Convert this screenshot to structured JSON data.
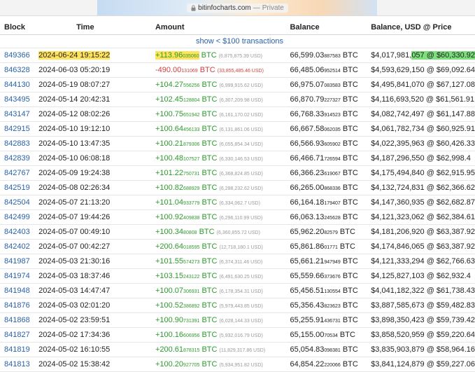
{
  "browser": {
    "host": "bitinfocharts.com",
    "separator": "—",
    "mode": "Private"
  },
  "table": {
    "headers": {
      "block": "Block",
      "time": "Time",
      "amount": "Amount",
      "balance": "Balance",
      "balance_usd": "Balance, USD @ Price"
    },
    "show_small_label": "show < $100 transactions",
    "unit": "BTC",
    "rows": [
      {
        "block": "849366",
        "time": "2024-06-24 19:15:22",
        "amount_main": "+113.96",
        "amount_frac": "035060",
        "amount_usd": "(6,875,875.39 USD)",
        "sign": "pos",
        "balance_main": "66,599.03",
        "balance_frac": "887583",
        "balance_usd": "$4,017,981,057 @ $60,330.92"
      },
      {
        "block": "846328",
        "time": "2024-06-03 05:20:19",
        "amount_main": "-490.00",
        "amount_frac": "131069",
        "amount_usd": "(33,855,485.46 USD)",
        "sign": "neg",
        "balance_main": "66,485.06",
        "balance_frac": "952514",
        "balance_usd": "$4,593,629,150 @ $69,092.64"
      },
      {
        "block": "844130",
        "time": "2024-05-19 08:07:27",
        "amount_main": "+104.27",
        "amount_frac": "556256",
        "amount_usd": "(6,999,915.62 USD)",
        "sign": "pos",
        "balance_main": "66,975.07",
        "balance_frac": "083583",
        "balance_usd": "$4,495,841,070 @ $67,127.08"
      },
      {
        "block": "843495",
        "time": "2024-05-14 20:42:31",
        "amount_main": "+102.45",
        "amount_frac": "128804",
        "amount_usd": "(6,307,209.98 USD)",
        "sign": "pos",
        "balance_main": "66,870.79",
        "balance_frac": "227327",
        "balance_usd": "$4,116,693,520 @ $61,561.91"
      },
      {
        "block": "843147",
        "time": "2024-05-12 08:02:26",
        "amount_main": "+100.75",
        "amount_frac": "651942",
        "amount_usd": "(6,161,170.02 USD)",
        "sign": "pos",
        "balance_main": "66,768.33",
        "balance_frac": "914523",
        "balance_usd": "$4,082,742,497 @ $61,147.88"
      },
      {
        "block": "842915",
        "time": "2024-05-10 19:12:10",
        "amount_main": "+100.64",
        "amount_frac": "456133",
        "amount_usd": "(6,131,861.06 USD)",
        "sign": "pos",
        "balance_main": "66,667.58",
        "balance_frac": "062035",
        "balance_usd": "$4,061,782,734 @ $60,925.91"
      },
      {
        "block": "842883",
        "time": "2024-05-10 13:47:35",
        "amount_main": "+100.21",
        "amount_frac": "879306",
        "amount_usd": "(6,055,854.34 USD)",
        "sign": "pos",
        "balance_main": "66,566.93",
        "balance_frac": "605902",
        "balance_usd": "$4,022,395,963 @ $60,426.33"
      },
      {
        "block": "842839",
        "time": "2024-05-10 06:08:18",
        "amount_main": "+100.48",
        "amount_frac": "107527",
        "amount_usd": "(6,330,146.53 USD)",
        "sign": "pos",
        "balance_main": "66,466.71",
        "balance_frac": "726594",
        "balance_usd": "$4,187,296,550 @ $62,998.4"
      },
      {
        "block": "842767",
        "time": "2024-05-09 19:24:38",
        "amount_main": "+101.22",
        "amount_frac": "750731",
        "amount_usd": "(6,368,824.85 USD)",
        "sign": "pos",
        "balance_main": "66,366.23",
        "balance_frac": "619067",
        "balance_usd": "$4,175,494,840 @ $62,915.95"
      },
      {
        "block": "842519",
        "time": "2024-05-08 02:26:34",
        "amount_main": "+100.82",
        "amount_frac": "688929",
        "amount_usd": "(6,288,232.62 USD)",
        "sign": "pos",
        "balance_main": "66,265.00",
        "balance_frac": "868336",
        "balance_usd": "$4,132,724,831 @ $62,366.62"
      },
      {
        "block": "842504",
        "time": "2024-05-07 21:13:20",
        "amount_main": "+101.04",
        "amount_frac": "933779",
        "amount_usd": "(6,334,062.7 USD)",
        "sign": "pos",
        "balance_main": "66,164.18",
        "balance_frac": "179407",
        "balance_usd": "$4,147,360,935 @ $62,682.87"
      },
      {
        "block": "842499",
        "time": "2024-05-07 19:44:26",
        "amount_main": "+100.92",
        "amount_frac": "409838",
        "amount_usd": "(6,296,110.99 USD)",
        "sign": "pos",
        "balance_main": "66,063.13",
        "balance_frac": "245628",
        "balance_usd": "$4,121,323,062 @ $62,384.61"
      },
      {
        "block": "842403",
        "time": "2024-05-07 00:49:10",
        "amount_main": "+100.34",
        "amount_frac": "80808",
        "amount_usd": "(6,360,855.72 USD)",
        "sign": "pos",
        "balance_main": "65,962.20",
        "balance_frac": "82579",
        "balance_usd": "$4,181,206,920 @ $63,387.92"
      },
      {
        "block": "842402",
        "time": "2024-05-07 00:42:27",
        "amount_main": "+200.64",
        "amount_frac": "018595",
        "amount_usd": "(12,718,180.1 USD)",
        "sign": "pos",
        "balance_main": "65,861.86",
        "balance_frac": "01771",
        "balance_usd": "$4,174,846,065 @ $63,387.92"
      },
      {
        "block": "841987",
        "time": "2024-05-03 21:30:16",
        "amount_main": "+101.55",
        "amount_frac": "574273",
        "amount_usd": "(6,374,311.46 USD)",
        "sign": "pos",
        "balance_main": "65,661.21",
        "balance_frac": "947949",
        "balance_usd": "$4,121,333,294 @ $62,766.63"
      },
      {
        "block": "841974",
        "time": "2024-05-03 18:37:46",
        "amount_main": "+103.15",
        "amount_frac": "243122",
        "amount_usd": "(6,491,630.25 USD)",
        "sign": "pos",
        "balance_main": "65,559.66",
        "balance_frac": "373676",
        "balance_usd": "$4,125,827,103 @ $62,932.4"
      },
      {
        "block": "841948",
        "time": "2024-05-03 14:47:47",
        "amount_main": "+100.07",
        "amount_frac": "306931",
        "amount_usd": "(6,178,354.31 USD)",
        "sign": "pos",
        "balance_main": "65,456.51",
        "balance_frac": "130554",
        "balance_usd": "$4,041,182,322 @ $61,738.43"
      },
      {
        "block": "841876",
        "time": "2024-05-03 02:01:20",
        "amount_main": "+100.52",
        "amount_frac": "386892",
        "amount_usd": "(5,979,443.85 USD)",
        "sign": "pos",
        "balance_main": "65,356.43",
        "balance_frac": "823623",
        "balance_usd": "$3,887,585,673 @ $59,482.83"
      },
      {
        "block": "841868",
        "time": "2024-05-02 23:59:51",
        "amount_main": "+100.90",
        "amount_frac": "731391",
        "amount_usd": "(6,028,144.33 USD)",
        "sign": "pos",
        "balance_main": "65,255.91",
        "balance_frac": "436731",
        "balance_usd": "$3,898,350,423 @ $59,739.42"
      },
      {
        "block": "841827",
        "time": "2024-05-02 17:34:36",
        "amount_main": "+100.16",
        "amount_frac": "606956",
        "amount_usd": "(5,932,016.79 USD)",
        "sign": "pos",
        "balance_main": "65,155.00",
        "balance_frac": "70534",
        "balance_usd": "$3,858,520,959 @ $59,220.64"
      },
      {
        "block": "841819",
        "time": "2024-05-02 16:10:55",
        "amount_main": "+200.61",
        "amount_frac": "878315",
        "amount_usd": "(11,829,317.86 USD)",
        "sign": "pos",
        "balance_main": "65,054.83",
        "balance_frac": "098381",
        "balance_usd": "$3,835,903,879 @ $58,964.16"
      },
      {
        "block": "841813",
        "time": "2024-05-02 15:38:42",
        "amount_main": "+100.20",
        "amount_frac": "927705",
        "amount_usd": "(5,934,951.82 USD)",
        "sign": "pos",
        "balance_main": "64,854.22",
        "balance_frac": "220066",
        "balance_usd": "$3,841,124,879 @ $59,227.06"
      }
    ]
  },
  "colors": {
    "link": "#2a62a8",
    "positive": "#2d9a2d",
    "negative": "#d04040",
    "highlight_yellow": "#ffe35b",
    "highlight_green": "#7be07b"
  }
}
